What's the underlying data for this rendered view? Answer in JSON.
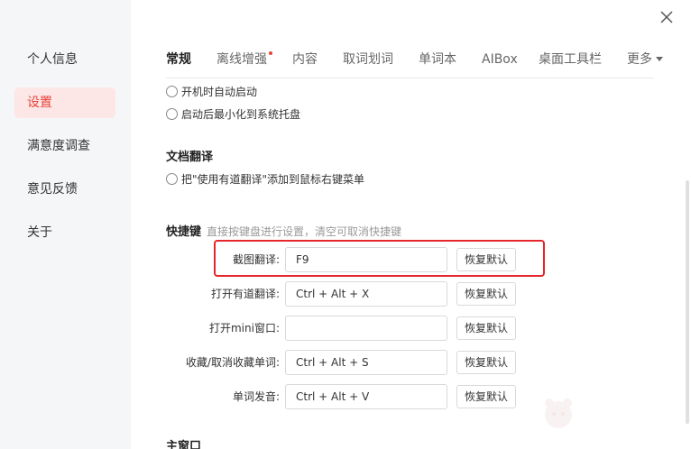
{
  "sidebar": {
    "items": [
      {
        "label": "个人信息",
        "active": false
      },
      {
        "label": "设置",
        "active": true
      },
      {
        "label": "满意度调查",
        "active": false
      },
      {
        "label": "意见反馈",
        "active": false
      },
      {
        "label": "关于",
        "active": false
      }
    ]
  },
  "tabs": [
    {
      "label": "常规",
      "active": true
    },
    {
      "label": "离线增强",
      "badge": true
    },
    {
      "label": "内容"
    },
    {
      "label": "取词划词"
    },
    {
      "label": "单词本"
    },
    {
      "label": "AIBox"
    },
    {
      "label": "桌面工具栏"
    },
    {
      "label": "更多"
    }
  ],
  "startup": {
    "auto_start": "开机时自动启动",
    "minimize_to_tray": "启动后最小化到系统托盘"
  },
  "doc_translate": {
    "title": "文档翻译",
    "context_menu": "把\"使用有道翻译\"添加到鼠标右键菜单"
  },
  "hotkeys": {
    "title": "快捷键",
    "hint": "直接按键盘进行设置，清空可取消快捷键",
    "reset_label": "恢复默认",
    "rows": [
      {
        "label": "截图翻译:",
        "value": "F9"
      },
      {
        "label": "打开有道翻译:",
        "value": "Ctrl + Alt + X"
      },
      {
        "label": "打开mini窗口:",
        "value": ""
      },
      {
        "label": "收藏/取消收藏单词:",
        "value": "Ctrl + Alt + S"
      },
      {
        "label": "单词发音:",
        "value": "Ctrl + Alt + V"
      }
    ]
  },
  "main_window": {
    "title": "主窗口"
  },
  "colors": {
    "accent": "#e8423a",
    "highlight_box": "#e5262b",
    "sidebar_bg": "#f5f6f8"
  },
  "icons": [
    "close-icon",
    "chevron-down-icon"
  ]
}
